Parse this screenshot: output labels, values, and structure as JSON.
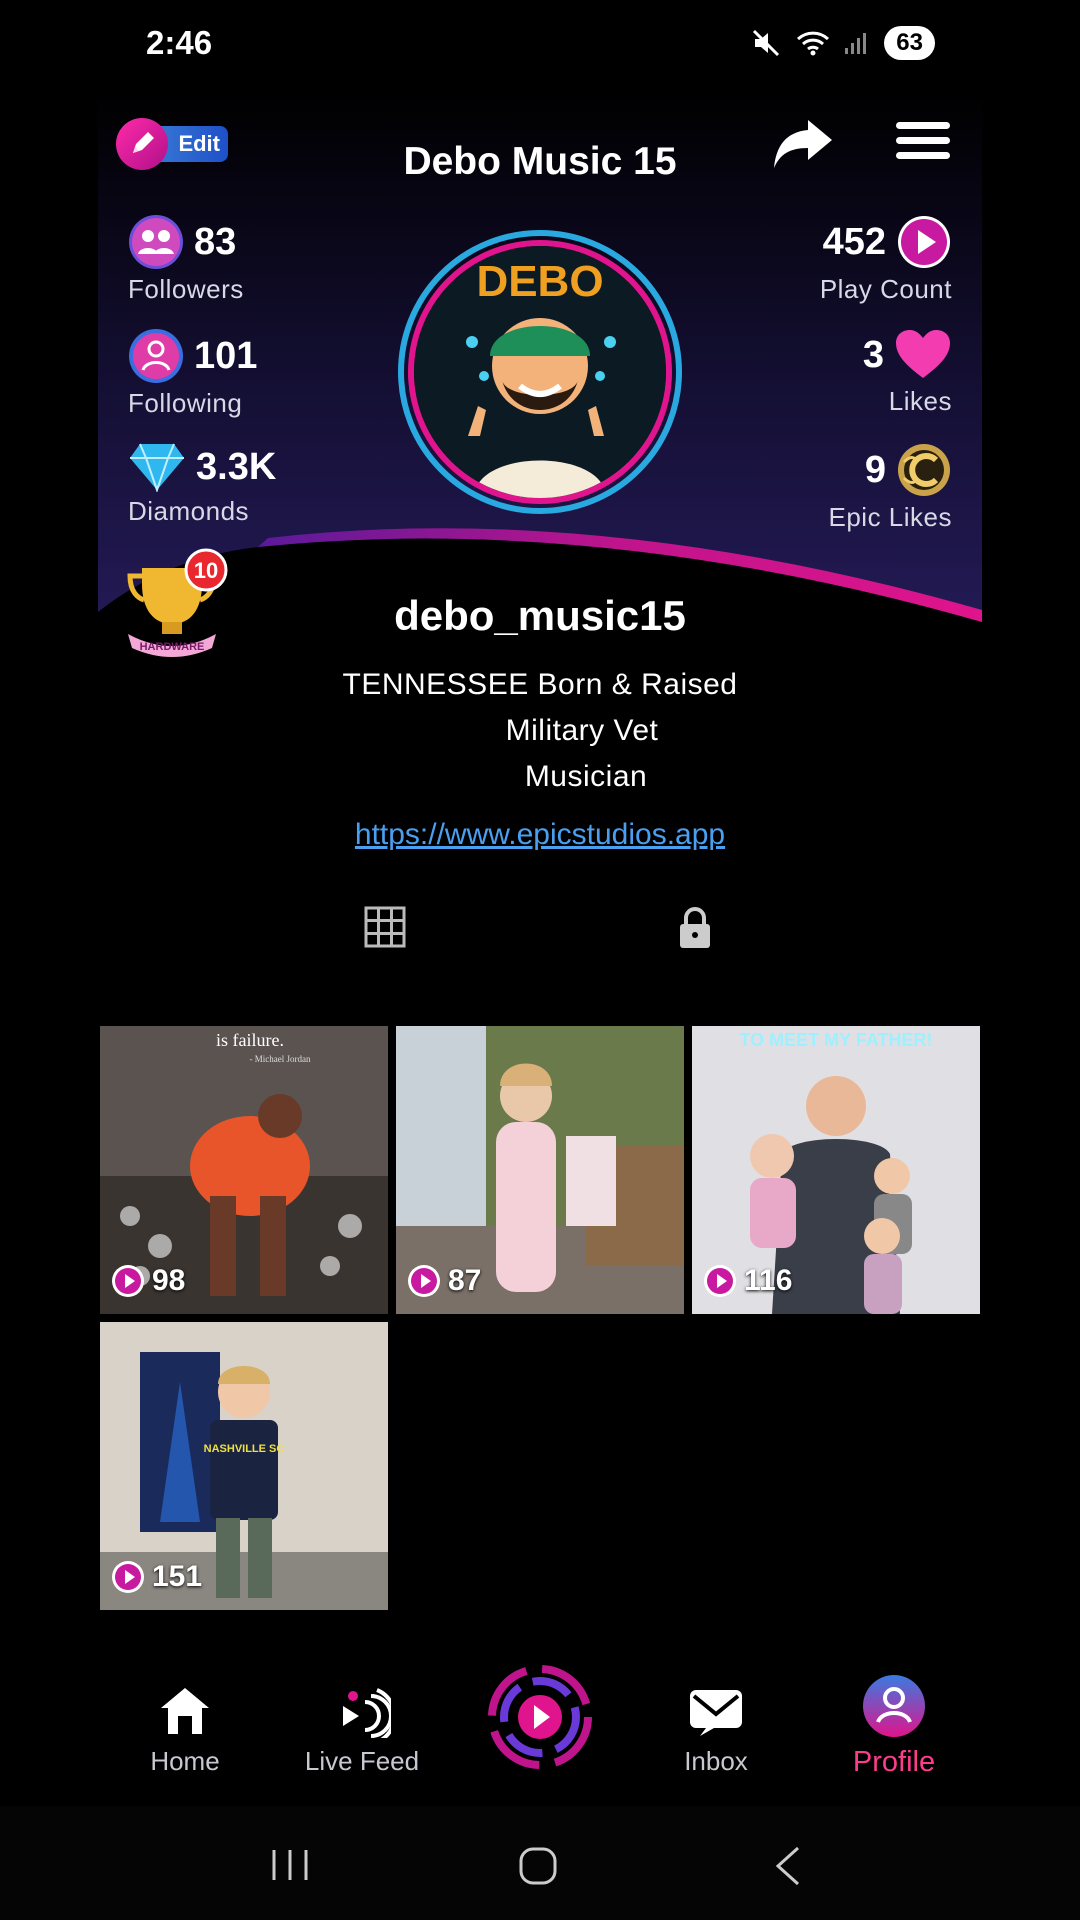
{
  "status_bar": {
    "time": "2:46",
    "battery": "63"
  },
  "header": {
    "edit_label": "Edit",
    "title": "Debo Music 15"
  },
  "stats": {
    "followers": {
      "value": "83",
      "label": "Followers"
    },
    "following": {
      "value": "101",
      "label": "Following"
    },
    "diamonds": {
      "value": "3.3K",
      "label": "Diamonds"
    },
    "play_count": {
      "value": "452",
      "label": "Play Count"
    },
    "likes": {
      "value": "3",
      "label": "Likes"
    },
    "epic_likes": {
      "value": "9",
      "label": "Epic Likes"
    }
  },
  "avatar": {
    "text": "DEBO"
  },
  "badge": {
    "count": "10",
    "label": "HARDWARE"
  },
  "profile": {
    "username": "debo_music15",
    "bio": [
      "TENNESSEE  Born & Raised",
      "Military Vet",
      "Musician"
    ],
    "link": "https://www.epicstudios.app"
  },
  "videos": [
    {
      "plays": "98",
      "caption": "is failure.",
      "credit": "- Michael Jordan"
    },
    {
      "plays": "87"
    },
    {
      "plays": "116",
      "caption": "TO MEET MY FATHER!"
    },
    {
      "plays": "151",
      "shirt": "NASHVILLE SC"
    }
  ],
  "nav": {
    "home": "Home",
    "live_feed": "Live Feed",
    "inbox": "Inbox",
    "profile": "Profile"
  },
  "colors": {
    "accent": "#e0148c",
    "link": "#4a9ff0",
    "header_bg": "#1a1440"
  }
}
